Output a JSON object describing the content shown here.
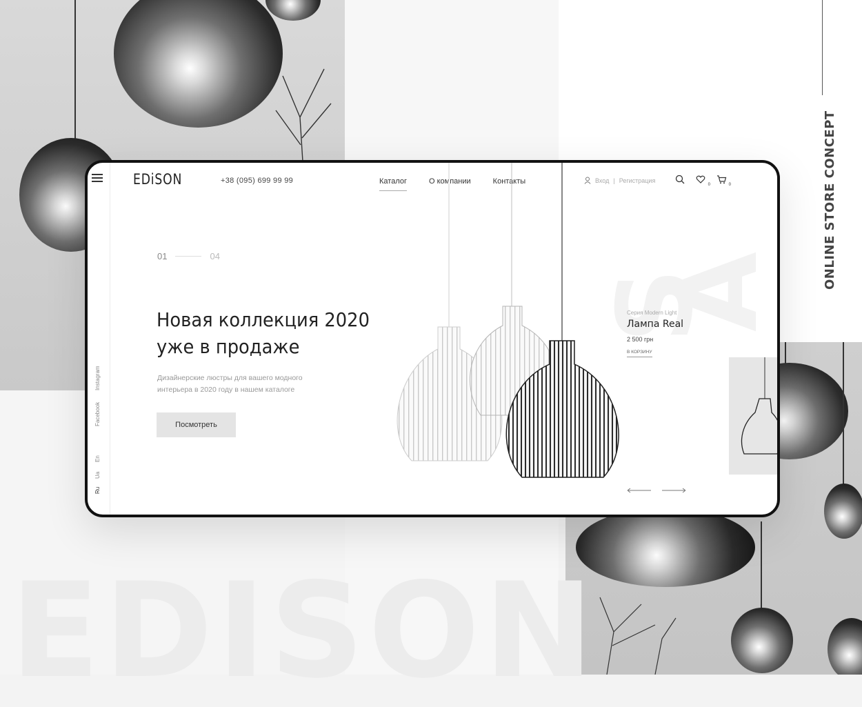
{
  "backdrop": {
    "watermark": "EDISON",
    "caption": "ONLINE STORE CONCEPT"
  },
  "header": {
    "logo": "EDiSON",
    "phone": "+38 (095) 699 99 99",
    "nav": [
      {
        "label": "Каталог",
        "active": true
      },
      {
        "label": "О компании",
        "active": false
      },
      {
        "label": "Контакты",
        "active": false
      }
    ],
    "login": "Вход",
    "separator": "|",
    "register": "Регистрация",
    "wishlist_count": "0",
    "cart_count": "0"
  },
  "sidebar": {
    "social": [
      "Instagram",
      "Facebook"
    ],
    "languages": [
      "En",
      "Ua",
      "Ru"
    ]
  },
  "hero": {
    "slide_current": "01",
    "slide_total": "04",
    "title_line1": "Новая коллекция 2020",
    "title_line2": "уже в продаже",
    "subtitle_line1": "Дизайнерские люстры для вашего модного",
    "subtitle_line2": "интерьера в 2020 году в нашем каталоге",
    "cta": "Посмотреть"
  },
  "product": {
    "series": "Серия Modern Light",
    "name": "Лампа Real",
    "price": "2 500 грн",
    "add_to_cart": "В корзину"
  },
  "colors": {
    "accent": "#222222",
    "muted": "#999999",
    "button_bg": "#e4e4e4"
  }
}
